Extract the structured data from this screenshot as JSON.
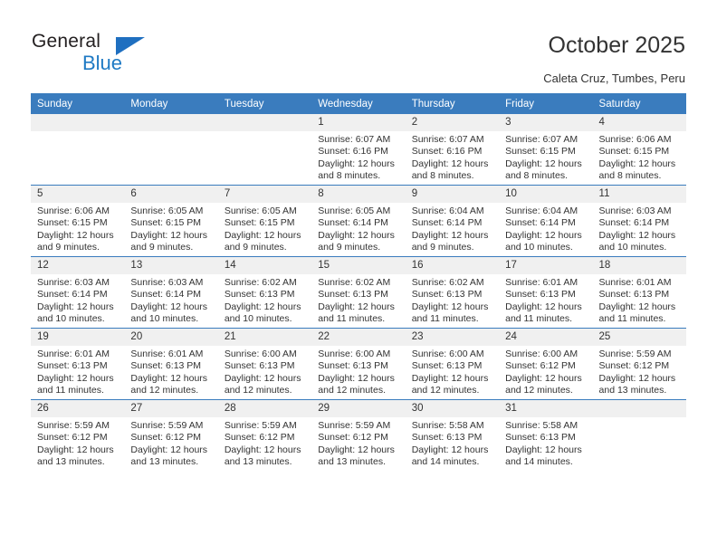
{
  "logo": {
    "word_one": "General",
    "word_two": "Blue",
    "triangle_color": "#1f6fc0",
    "blue_color": "#1f7ac4"
  },
  "header": {
    "title": "October 2025",
    "subtitle": "Caleta Cruz, Tumbes, Peru"
  },
  "theme": {
    "header_blue": "#3a7cbe",
    "daynum_band": "#f0f0f0",
    "text": "#333333"
  },
  "weekday_headers": [
    "Sunday",
    "Monday",
    "Tuesday",
    "Wednesday",
    "Thursday",
    "Friday",
    "Saturday"
  ],
  "weeks": [
    [
      {
        "day": "",
        "sunrise": "",
        "sunset": "",
        "daylight_line1": "",
        "daylight_line2": ""
      },
      {
        "day": "",
        "sunrise": "",
        "sunset": "",
        "daylight_line1": "",
        "daylight_line2": ""
      },
      {
        "day": "",
        "sunrise": "",
        "sunset": "",
        "daylight_line1": "",
        "daylight_line2": ""
      },
      {
        "day": "1",
        "sunrise": "Sunrise: 6:07 AM",
        "sunset": "Sunset: 6:16 PM",
        "daylight_line1": "Daylight: 12 hours",
        "daylight_line2": "and 8 minutes."
      },
      {
        "day": "2",
        "sunrise": "Sunrise: 6:07 AM",
        "sunset": "Sunset: 6:16 PM",
        "daylight_line1": "Daylight: 12 hours",
        "daylight_line2": "and 8 minutes."
      },
      {
        "day": "3",
        "sunrise": "Sunrise: 6:07 AM",
        "sunset": "Sunset: 6:15 PM",
        "daylight_line1": "Daylight: 12 hours",
        "daylight_line2": "and 8 minutes."
      },
      {
        "day": "4",
        "sunrise": "Sunrise: 6:06 AM",
        "sunset": "Sunset: 6:15 PM",
        "daylight_line1": "Daylight: 12 hours",
        "daylight_line2": "and 8 minutes."
      }
    ],
    [
      {
        "day": "5",
        "sunrise": "Sunrise: 6:06 AM",
        "sunset": "Sunset: 6:15 PM",
        "daylight_line1": "Daylight: 12 hours",
        "daylight_line2": "and 9 minutes."
      },
      {
        "day": "6",
        "sunrise": "Sunrise: 6:05 AM",
        "sunset": "Sunset: 6:15 PM",
        "daylight_line1": "Daylight: 12 hours",
        "daylight_line2": "and 9 minutes."
      },
      {
        "day": "7",
        "sunrise": "Sunrise: 6:05 AM",
        "sunset": "Sunset: 6:15 PM",
        "daylight_line1": "Daylight: 12 hours",
        "daylight_line2": "and 9 minutes."
      },
      {
        "day": "8",
        "sunrise": "Sunrise: 6:05 AM",
        "sunset": "Sunset: 6:14 PM",
        "daylight_line1": "Daylight: 12 hours",
        "daylight_line2": "and 9 minutes."
      },
      {
        "day": "9",
        "sunrise": "Sunrise: 6:04 AM",
        "sunset": "Sunset: 6:14 PM",
        "daylight_line1": "Daylight: 12 hours",
        "daylight_line2": "and 9 minutes."
      },
      {
        "day": "10",
        "sunrise": "Sunrise: 6:04 AM",
        "sunset": "Sunset: 6:14 PM",
        "daylight_line1": "Daylight: 12 hours",
        "daylight_line2": "and 10 minutes."
      },
      {
        "day": "11",
        "sunrise": "Sunrise: 6:03 AM",
        "sunset": "Sunset: 6:14 PM",
        "daylight_line1": "Daylight: 12 hours",
        "daylight_line2": "and 10 minutes."
      }
    ],
    [
      {
        "day": "12",
        "sunrise": "Sunrise: 6:03 AM",
        "sunset": "Sunset: 6:14 PM",
        "daylight_line1": "Daylight: 12 hours",
        "daylight_line2": "and 10 minutes."
      },
      {
        "day": "13",
        "sunrise": "Sunrise: 6:03 AM",
        "sunset": "Sunset: 6:14 PM",
        "daylight_line1": "Daylight: 12 hours",
        "daylight_line2": "and 10 minutes."
      },
      {
        "day": "14",
        "sunrise": "Sunrise: 6:02 AM",
        "sunset": "Sunset: 6:13 PM",
        "daylight_line1": "Daylight: 12 hours",
        "daylight_line2": "and 10 minutes."
      },
      {
        "day": "15",
        "sunrise": "Sunrise: 6:02 AM",
        "sunset": "Sunset: 6:13 PM",
        "daylight_line1": "Daylight: 12 hours",
        "daylight_line2": "and 11 minutes."
      },
      {
        "day": "16",
        "sunrise": "Sunrise: 6:02 AM",
        "sunset": "Sunset: 6:13 PM",
        "daylight_line1": "Daylight: 12 hours",
        "daylight_line2": "and 11 minutes."
      },
      {
        "day": "17",
        "sunrise": "Sunrise: 6:01 AM",
        "sunset": "Sunset: 6:13 PM",
        "daylight_line1": "Daylight: 12 hours",
        "daylight_line2": "and 11 minutes."
      },
      {
        "day": "18",
        "sunrise": "Sunrise: 6:01 AM",
        "sunset": "Sunset: 6:13 PM",
        "daylight_line1": "Daylight: 12 hours",
        "daylight_line2": "and 11 minutes."
      }
    ],
    [
      {
        "day": "19",
        "sunrise": "Sunrise: 6:01 AM",
        "sunset": "Sunset: 6:13 PM",
        "daylight_line1": "Daylight: 12 hours",
        "daylight_line2": "and 11 minutes."
      },
      {
        "day": "20",
        "sunrise": "Sunrise: 6:01 AM",
        "sunset": "Sunset: 6:13 PM",
        "daylight_line1": "Daylight: 12 hours",
        "daylight_line2": "and 12 minutes."
      },
      {
        "day": "21",
        "sunrise": "Sunrise: 6:00 AM",
        "sunset": "Sunset: 6:13 PM",
        "daylight_line1": "Daylight: 12 hours",
        "daylight_line2": "and 12 minutes."
      },
      {
        "day": "22",
        "sunrise": "Sunrise: 6:00 AM",
        "sunset": "Sunset: 6:13 PM",
        "daylight_line1": "Daylight: 12 hours",
        "daylight_line2": "and 12 minutes."
      },
      {
        "day": "23",
        "sunrise": "Sunrise: 6:00 AM",
        "sunset": "Sunset: 6:13 PM",
        "daylight_line1": "Daylight: 12 hours",
        "daylight_line2": "and 12 minutes."
      },
      {
        "day": "24",
        "sunrise": "Sunrise: 6:00 AM",
        "sunset": "Sunset: 6:12 PM",
        "daylight_line1": "Daylight: 12 hours",
        "daylight_line2": "and 12 minutes."
      },
      {
        "day": "25",
        "sunrise": "Sunrise: 5:59 AM",
        "sunset": "Sunset: 6:12 PM",
        "daylight_line1": "Daylight: 12 hours",
        "daylight_line2": "and 13 minutes."
      }
    ],
    [
      {
        "day": "26",
        "sunrise": "Sunrise: 5:59 AM",
        "sunset": "Sunset: 6:12 PM",
        "daylight_line1": "Daylight: 12 hours",
        "daylight_line2": "and 13 minutes."
      },
      {
        "day": "27",
        "sunrise": "Sunrise: 5:59 AM",
        "sunset": "Sunset: 6:12 PM",
        "daylight_line1": "Daylight: 12 hours",
        "daylight_line2": "and 13 minutes."
      },
      {
        "day": "28",
        "sunrise": "Sunrise: 5:59 AM",
        "sunset": "Sunset: 6:12 PM",
        "daylight_line1": "Daylight: 12 hours",
        "daylight_line2": "and 13 minutes."
      },
      {
        "day": "29",
        "sunrise": "Sunrise: 5:59 AM",
        "sunset": "Sunset: 6:12 PM",
        "daylight_line1": "Daylight: 12 hours",
        "daylight_line2": "and 13 minutes."
      },
      {
        "day": "30",
        "sunrise": "Sunrise: 5:58 AM",
        "sunset": "Sunset: 6:13 PM",
        "daylight_line1": "Daylight: 12 hours",
        "daylight_line2": "and 14 minutes."
      },
      {
        "day": "31",
        "sunrise": "Sunrise: 5:58 AM",
        "sunset": "Sunset: 6:13 PM",
        "daylight_line1": "Daylight: 12 hours",
        "daylight_line2": "and 14 minutes."
      },
      {
        "day": "",
        "sunrise": "",
        "sunset": "",
        "daylight_line1": "",
        "daylight_line2": ""
      }
    ]
  ]
}
